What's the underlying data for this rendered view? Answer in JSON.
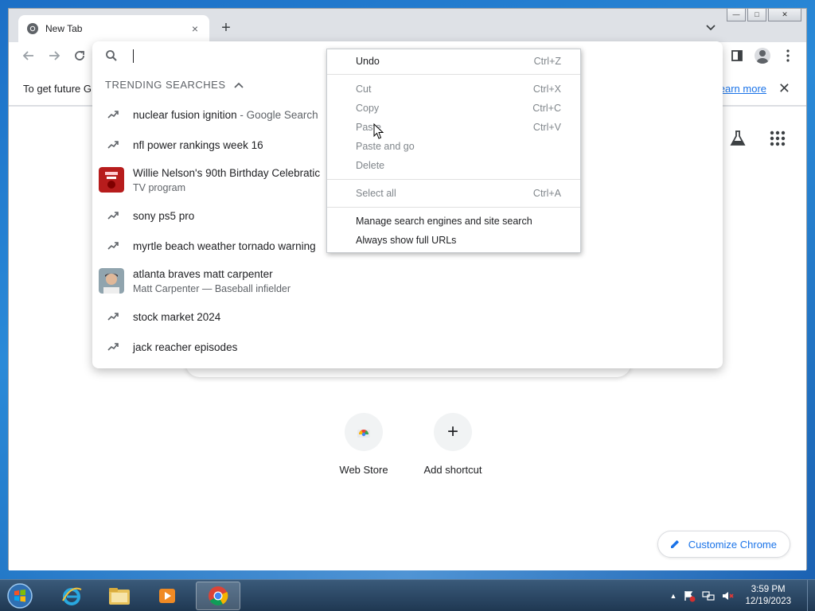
{
  "browser": {
    "tab_title": "New Tab",
    "new_tab_symbol": "+",
    "close_symbol": "×",
    "window_controls": {
      "minimize": "—",
      "maximize": "□",
      "close": "✕"
    }
  },
  "infobar": {
    "text": "To get future G",
    "learn_more": "earn more",
    "close_symbol": "✕"
  },
  "omnibox": {
    "trending_header": "TRENDING SEARCHES",
    "suggestions": [
      {
        "text": "nuclear fusion ignition",
        "suffix": " - Google Search",
        "type": "trend"
      },
      {
        "text": "nfl power rankings week 16",
        "type": "trend"
      },
      {
        "text": "Willie Nelson's 90th Birthday Celebratic",
        "subtext": "TV program",
        "type": "entity"
      },
      {
        "text": "sony ps5 pro",
        "type": "trend"
      },
      {
        "text": "myrtle beach weather tornado warning",
        "type": "trend"
      },
      {
        "text": "atlanta braves matt carpenter",
        "subtext": "Matt Carpenter — Baseball infielder",
        "type": "entity"
      },
      {
        "text": "stock market 2024",
        "type": "trend"
      },
      {
        "text": "jack reacher episodes",
        "type": "trend"
      }
    ]
  },
  "context_menu": {
    "undo": {
      "label": "Undo",
      "shortcut": "Ctrl+Z"
    },
    "cut": {
      "label": "Cut",
      "shortcut": "Ctrl+X"
    },
    "copy": {
      "label": "Copy",
      "shortcut": "Ctrl+C"
    },
    "paste": {
      "label": "Paste",
      "shortcut": "Ctrl+V"
    },
    "paste_and_go": {
      "label": "Paste and go"
    },
    "delete": {
      "label": "Delete"
    },
    "select_all": {
      "label": "Select all",
      "shortcut": "Ctrl+A"
    },
    "manage_search": {
      "label": "Manage search engines and site search"
    },
    "always_full_urls": {
      "label": "Always show full URLs"
    }
  },
  "ntp": {
    "shortcuts": [
      {
        "label": "Web Store"
      },
      {
        "label": "Add shortcut",
        "symbol": "+"
      }
    ],
    "customize": "Customize Chrome"
  },
  "taskbar": {
    "time": "3:59 PM",
    "date": "12/19/2023"
  },
  "colors": {
    "accent": "#1a73e8",
    "disabled_text": "#80868b"
  }
}
